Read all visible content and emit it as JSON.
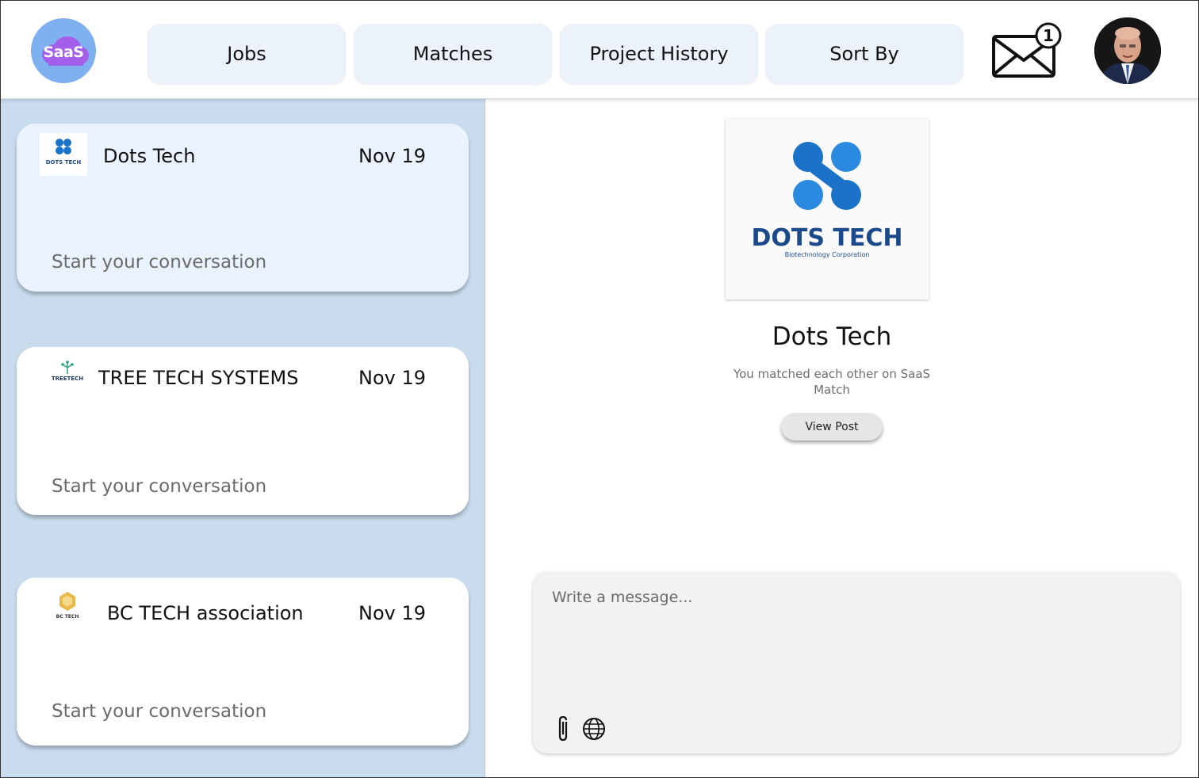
{
  "brand": {
    "logo_text": "SaaS"
  },
  "nav": {
    "items": [
      {
        "label": "Jobs"
      },
      {
        "label": "Matches"
      },
      {
        "label": "Project History"
      },
      {
        "label": "Sort By"
      }
    ]
  },
  "notifications": {
    "count": "1",
    "icon": "mail-icon"
  },
  "conversations": [
    {
      "company": "Dots Tech",
      "date": "Nov 19",
      "preview": "Start your conversation",
      "logo_text": "DOTS TECH",
      "active": true
    },
    {
      "company": "TREE TECH SYSTEMS",
      "date": "Nov 19",
      "preview": "Start your conversation",
      "logo_text": "TREETECH",
      "active": false
    },
    {
      "company": "BC TECH association",
      "date": "Nov 19",
      "preview": "Start your conversation",
      "logo_text": "BC TECH",
      "active": false
    }
  ],
  "profile": {
    "name": "Dots Tech",
    "logo_title": "DOTS TECH",
    "logo_subtitle": "Biotechnology Corporation",
    "match_text": "You matched each other on SaaS Match",
    "view_post_label": "View Post"
  },
  "composer": {
    "placeholder": "Write a message...",
    "attach_icon": "paperclip-icon",
    "globe_icon": "globe-icon"
  },
  "colors": {
    "sidebar_bg": "#c9dcee",
    "active_card": "#eaf3fd",
    "nav_button": "#ecf2f9",
    "brand_blue": "#1a73c9"
  }
}
